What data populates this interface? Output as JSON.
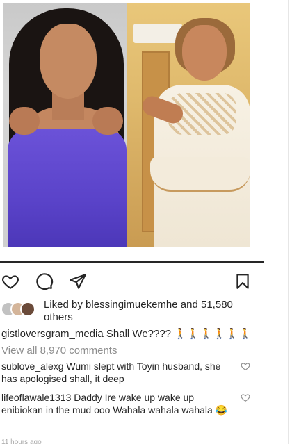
{
  "post": {
    "images": [
      {
        "description": "left-photo"
      },
      {
        "description": "right-photo"
      }
    ]
  },
  "actions": {
    "like_icon": "heart-outline-icon",
    "comment_icon": "comment-bubble-icon",
    "share_icon": "paper-plane-icon",
    "save_icon": "bookmark-icon"
  },
  "likes": {
    "prefix": "Liked by ",
    "user": "blessingimuekemhe",
    "middle": " and ",
    "count": "51,580",
    "suffix": "others"
  },
  "caption": {
    "user": "gistloversgram_media",
    "text": "Shall We????",
    "emoji": "🚶🚶🚶🚶🚶🚶"
  },
  "view_all": "View all 8,970 comments",
  "comments": [
    {
      "user": "sublove_alexg",
      "text": "Wumi slept with Toyin husband, she has apologised shall, it deep"
    },
    {
      "user": "lifeoflawale1313",
      "text": "Daddy Ire wake up wake up enibiokan in the mud ooo Wahala wahala wahala 😂"
    }
  ],
  "timestamp": "11 hours ago",
  "colors": {
    "text": "#262626",
    "muted": "#8e8e8e"
  }
}
